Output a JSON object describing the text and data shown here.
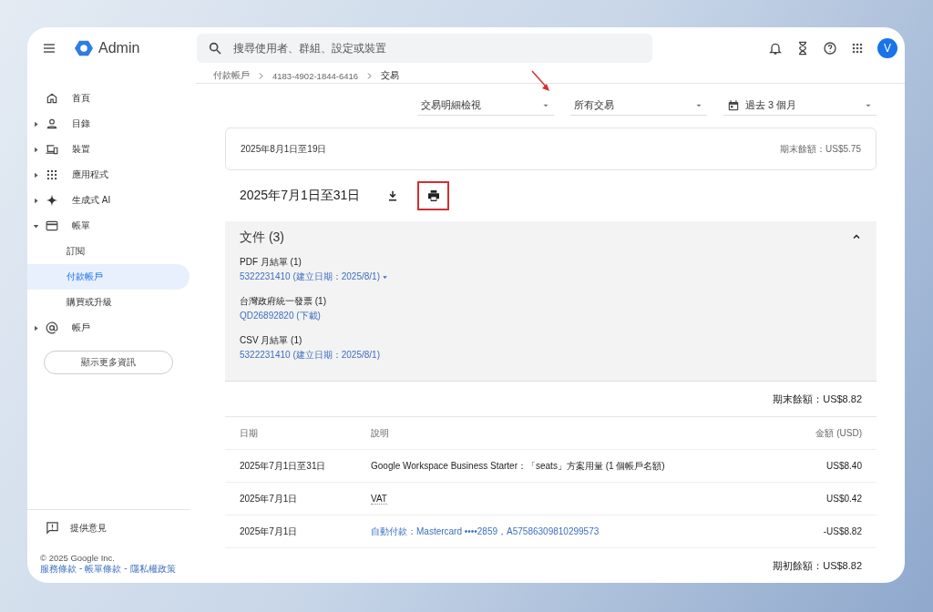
{
  "header": {
    "product": "Admin",
    "search": {
      "placeholder": "搜尋使用者、群組、設定或裝置"
    },
    "avatar": "V"
  },
  "sidebar": {
    "items": [
      {
        "label": "首頁",
        "expandable": false,
        "selected": false
      },
      {
        "label": "目錄",
        "expandable": true,
        "expanded": false,
        "selected": false
      },
      {
        "label": "裝置",
        "expandable": true,
        "expanded": false,
        "selected": false
      },
      {
        "label": "應用程式",
        "expandable": true,
        "expanded": false,
        "selected": false
      },
      {
        "label": "生成式 AI",
        "expandable": true,
        "expanded": false,
        "selected": false
      },
      {
        "label": "帳單",
        "expandable": true,
        "expanded": true,
        "selected": false,
        "children": [
          {
            "label": "訂閱",
            "selected": false
          },
          {
            "label": "付款帳戶",
            "selected": true
          },
          {
            "label": "購買或升級",
            "selected": false
          }
        ]
      },
      {
        "label": "帳戶",
        "expandable": true,
        "expanded": false,
        "selected": false
      }
    ],
    "more_button": "顯示更多資訊",
    "feedback": "提供意見",
    "copyright": "© 2025 Google Inc.",
    "footer_links": [
      "服務條款",
      "帳單條款",
      "隱私權政策"
    ],
    "footer_separator": "-"
  },
  "breadcrumb": [
    "付款帳戶",
    "4183-4902-1844-6416",
    "交易"
  ],
  "filters": [
    {
      "value": "交易明細檢視"
    },
    {
      "value": "所有交易"
    },
    {
      "value": "過去 3 個月"
    }
  ],
  "current_period": {
    "range": "2025年8月1日至19日",
    "balance": "期末餘額：US$5.75"
  },
  "statement": {
    "title": "2025年7月1日至31日",
    "print_highlighted": true,
    "documents": {
      "title": "文件 (3)",
      "expanded": true,
      "groups": [
        {
          "name": "PDF 月結單 (1)",
          "link": "5322231410 (建立日期：2025/8/1)",
          "menu": true
        },
        {
          "name": "台灣政府統一發票 (1)",
          "link": "QD26892820 (下載)",
          "menu": false
        },
        {
          "name": "CSV 月結單 (1)",
          "link": "5322231410 (建立日期：2025/8/1)",
          "menu": false
        }
      ]
    },
    "closing_balance": "期末餘額：US$8.82",
    "table": {
      "columns": [
        "日期",
        "說明",
        "金額 (USD)"
      ],
      "rows": [
        {
          "date": "2025年7月1日至31日",
          "description": "Google Workspace Business Starter：「seats」方案用量 (1 個帳戶名額)",
          "kind": "plain",
          "amount": "US$8.40"
        },
        {
          "date": "2025年7月1日",
          "description": "VAT",
          "kind": "tooltip",
          "amount": "US$0.42"
        },
        {
          "date": "2025年7月1日",
          "description": "自動付款：Mastercard ••••2859，A57586309810299573",
          "kind": "link",
          "amount": "-US$8.82"
        }
      ]
    },
    "opening_balance": "期初餘額：US$8.82"
  }
}
